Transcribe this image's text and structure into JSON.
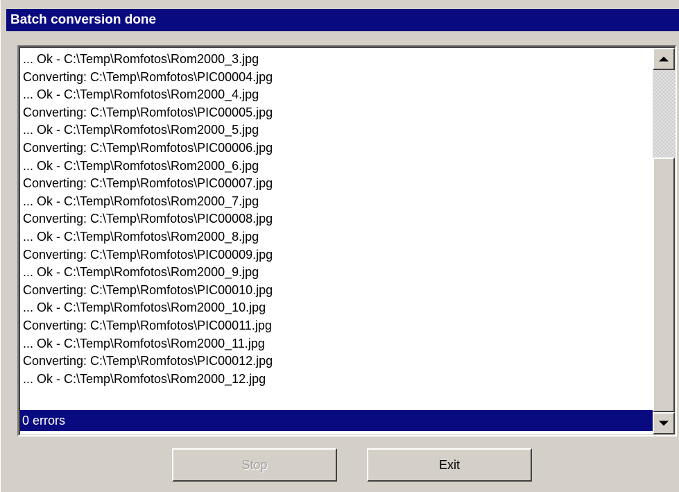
{
  "window": {
    "title": "Batch conversion done"
  },
  "log": {
    "lines": [
      "... Ok - C:\\Temp\\Romfotos\\Rom2000_3.jpg",
      "Converting: C:\\Temp\\Romfotos\\PIC00004.jpg",
      "... Ok - C:\\Temp\\Romfotos\\Rom2000_4.jpg",
      "Converting: C:\\Temp\\Romfotos\\PIC00005.jpg",
      "... Ok - C:\\Temp\\Romfotos\\Rom2000_5.jpg",
      "Converting: C:\\Temp\\Romfotos\\PIC00006.jpg",
      "... Ok - C:\\Temp\\Romfotos\\Rom2000_6.jpg",
      "Converting: C:\\Temp\\Romfotos\\PIC00007.jpg",
      "... Ok - C:\\Temp\\Romfotos\\Rom2000_7.jpg",
      "Converting: C:\\Temp\\Romfotos\\PIC00008.jpg",
      "... Ok - C:\\Temp\\Romfotos\\Rom2000_8.jpg",
      "Converting: C:\\Temp\\Romfotos\\PIC00009.jpg",
      "... Ok - C:\\Temp\\Romfotos\\Rom2000_9.jpg",
      "Converting: C:\\Temp\\Romfotos\\PIC00010.jpg",
      "... Ok - C:\\Temp\\Romfotos\\Rom2000_10.jpg",
      "Converting: C:\\Temp\\Romfotos\\PIC00011.jpg",
      "... Ok - C:\\Temp\\Romfotos\\Rom2000_11.jpg",
      "Converting: C:\\Temp\\Romfotos\\PIC00012.jpg",
      "... Ok - C:\\Temp\\Romfotos\\Rom2000_12.jpg"
    ],
    "selected_line": "0 errors"
  },
  "scrollbar": {
    "up_icon": "arrow-up-icon",
    "down_icon": "arrow-down-icon"
  },
  "buttons": {
    "stop_label": "Stop",
    "stop_enabled": false,
    "exit_label": "Exit"
  },
  "colors": {
    "title_bar": "#0a0a80",
    "selection": "#0a0a80",
    "face": "#d4d0c8"
  }
}
